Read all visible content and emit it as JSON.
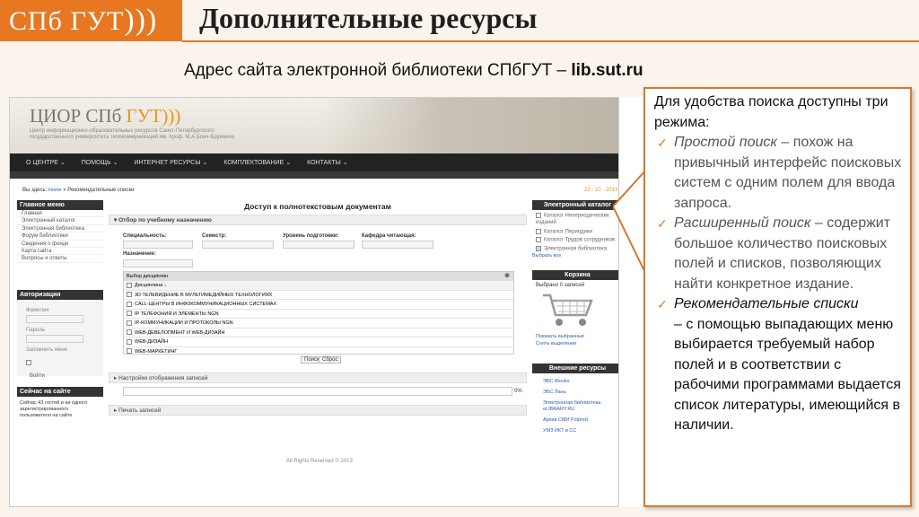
{
  "header": {
    "logo": "СПб ГУТ",
    "logo_brackets": ")))",
    "title": "Дополнительные ресурсы",
    "subtitle_text": "Адрес сайта электронной библиотеки СПбГУТ – ",
    "subtitle_link": "lib.sut.ru"
  },
  "colors": {
    "accent": "#e87722",
    "dark_nav": "#222222",
    "callout_border": "#d27a34"
  },
  "site": {
    "logo": "ЦИОР СПб",
    "logo_accent": "ГУТ)))",
    "logo_sub": "Центр информационно-образовательных ресурсов Санкт-Петербургского государственного университета телекоммуникаций им. проф. М.А.Бонч-Бруевича",
    "nav": [
      "О ЦЕНТРЕ ⌄",
      "ПОМОЩЬ ⌄",
      "ИНТЕРНЕТ РЕСУРСЫ ⌄",
      "КОМПЛЕКТОВАНИЕ ⌄",
      "КОНТАКТЫ ⌄"
    ],
    "breadcrumb_prefix": "Вы здесь:",
    "breadcrumb_home": "Home",
    "breadcrumb_current": "» Рекомендательные списки",
    "date": "23 - 10 - 2013",
    "main_menu_title": "Главное меню",
    "main_menu": [
      "Главная",
      "Электронный каталог",
      "Электронная библиотека",
      "Форум библиотеки",
      "Сведения о фонде",
      "Карта сайта",
      "Вопросы и ответы"
    ],
    "auth_title": "Авторизация",
    "auth_login": "Фамилия",
    "auth_pass": "Пароль",
    "auth_remember": "Запомнить меня",
    "auth_btn": "Войти",
    "online_title": "Сейчас на сайте",
    "online_text": "Сейчас 43 гостей и ни одного зарегистрированного пользователя на сайте",
    "page_heading": "Доступ к полнотекстовым документам",
    "filter_title": "Отбор по учебному назначению",
    "filter_labels": [
      "Специальность:",
      "Семестр:",
      "Уровень подготовки:",
      "Кафедра читающая:"
    ],
    "purpose_label": "Назначение:",
    "disc_title": "Выбор дисциплин",
    "disc_header": "Дисциплина ↓",
    "disciplines": [
      "3D ТЕЛЕВИДЕНИЕ В МУЛЬТИМЕДИЙНЫХ ТЕХНОЛОГИЯХ",
      "CALL-ЦЕНТРЫ В ИНФОКОММУНИКАЦИОННЫХ СИСТЕМАХ",
      "IP ТЕЛЕФОНИЯ И ЭЛЕМЕНТЫ NGN",
      "IP-КОММУНИКАЦИИ И ПРОТОКОЛЫ NGN",
      "WEB-ДЕВЕЛОПМЕНТ И WEB-ДИЗАЙН",
      "WEB-ДИЗАЙН",
      "WEB-МАРКЕТИНГ"
    ],
    "btn_search": "Поиск",
    "btn_reset": "Сброс",
    "display_settings": "Настройки отображения записей",
    "progress_label": "0%",
    "print_records": "Печать записей",
    "catalog_title": "Электронный каталог",
    "catalog_items": [
      "Каталог Непериодических изданий",
      "Каталог Периодики",
      "Каталог Трудов сотрудников",
      "Электронная библиотека"
    ],
    "select_all": "Выбрать все",
    "cart_title": "Корзина",
    "cart_count": "Выбрано 0 записей",
    "cart_show": "Показать выбранные",
    "cart_clear": "Снять выделение",
    "ext_title": "Внешние ресурсы",
    "ext_items": [
      "ЭБС iBooks",
      "ЭБС Лань",
      "Электронная библиотека eLIBRARY.RU",
      "Архив СМИ Polpred",
      "УМЗ ИКТ в СС"
    ],
    "footer": "All Rights Reserved © 2013"
  },
  "callout": {
    "intro": "Для удобства поиска доступны три режима:",
    "items": [
      {
        "title": "Простой поиск",
        "text": " – похож на привычный интерфейс поисковых систем с одним полем для ввода запроса."
      },
      {
        "title": "Расширенный поиск",
        "text": " – содержит большое количество поисковых полей и списков, позволяющих найти конкретное издание."
      },
      {
        "title": "Рекомендательные списки",
        "text": " – с помощью выпадающих меню выбирается требуемый набор полей и в соответствии с рабочими программами выдается список литературы, имеющийся в наличии."
      }
    ]
  }
}
